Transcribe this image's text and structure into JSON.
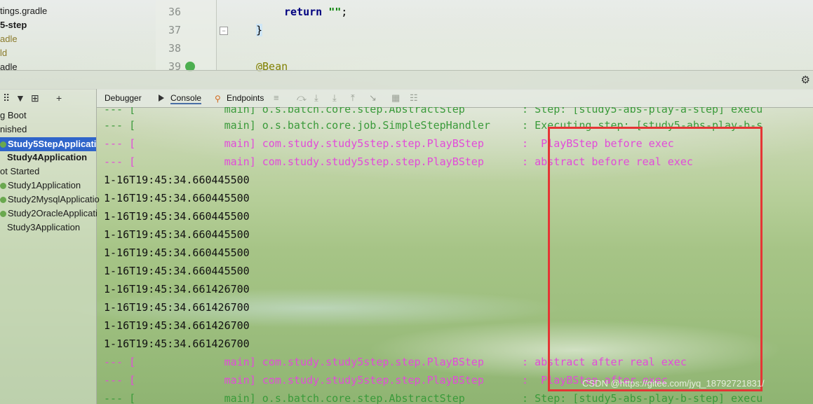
{
  "project": {
    "lines": [
      "tings.gradle",
      "5-step",
      "adle",
      "ld",
      "adle"
    ]
  },
  "editor": {
    "line_numbers": [
      "36",
      "37",
      "38",
      "39"
    ],
    "return_kw": "return",
    "return_str": "\"\"",
    "return_semi": ";",
    "close_brace": "}",
    "annotation": "@Bean"
  },
  "run_panel": {
    "tree": [
      {
        "label": "g Boot"
      },
      {
        "label": "nished"
      },
      {
        "label": "Study5StepApplicati"
      },
      {
        "label": "Study4Application"
      },
      {
        "label": "ot Started"
      },
      {
        "label": "Study1Application"
      },
      {
        "label": "Study2MysqlApplicatio"
      },
      {
        "label": "Study2OracleApplicati"
      },
      {
        "label": "Study3Application"
      }
    ],
    "tabs": {
      "debugger": "Debugger",
      "console": "Console",
      "endpoints": "Endpoints"
    }
  },
  "console": {
    "lines": [
      {
        "prefix": "--- [",
        "thread": "main]",
        "logger": "o.s.batch.core.step.AbstractStep",
        "msg": ": Step: [study5-abs-play-a-step] execu"
      },
      {
        "prefix": "--- [",
        "thread": "main]",
        "logger": "o.s.batch.core.job.SimpleStepHandler",
        "msg": ": Executing step: [study5-abs-play-b-s"
      },
      {
        "prefix": "--- [",
        "thread": "main]",
        "logger": "com.study.study5step.step.PlayBStep",
        "msg": ":  PlayBStep before exec"
      },
      {
        "prefix": "--- [",
        "thread": "main]",
        "logger": "com.study.study5step.step.PlayBStep",
        "msg": ": abstract before real exec"
      },
      {
        "text": "1-16T19:45:34.660445500"
      },
      {
        "text": "1-16T19:45:34.660445500"
      },
      {
        "text": "1-16T19:45:34.660445500"
      },
      {
        "text": "1-16T19:45:34.660445500"
      },
      {
        "text": "1-16T19:45:34.660445500"
      },
      {
        "text": "1-16T19:45:34.660445500"
      },
      {
        "text": "1-16T19:45:34.661426700"
      },
      {
        "text": "1-16T19:45:34.661426700"
      },
      {
        "text": "1-16T19:45:34.661426700"
      },
      {
        "text": "1-16T19:45:34.661426700"
      },
      {
        "prefix": "--- [",
        "thread": "main]",
        "logger": "com.study.study5step.step.PlayBStep",
        "msg": ": abstract after real exec"
      },
      {
        "prefix": "--- [",
        "thread": "main]",
        "logger": "com.study.study5step.step.PlayBStep",
        "msg": ":  PlayBStep after exec"
      },
      {
        "prefix": "--- [",
        "thread": "main]",
        "logger": "o.s.batch.core.step.AbstractStep",
        "msg": ": Step: [study5-abs-play-b-step] execu"
      }
    ]
  },
  "watermark": "CSDN @https://gitee.com/jyq_18792721831/",
  "colors": {
    "info_green": "#3a9a3a",
    "highlight_pink": "#e24bd9",
    "box_red": "#e53535",
    "selection_blue": "#2f65ca"
  }
}
